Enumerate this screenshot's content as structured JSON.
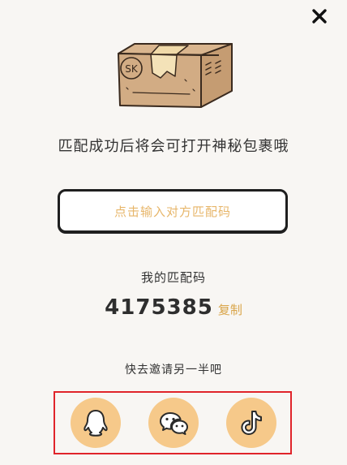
{
  "dialog": {
    "close_icon": "close-icon",
    "illustration": {
      "icon": "mystery-box",
      "label": "SK"
    },
    "headline": "匹配成功后将会可打开神秘包裹哦",
    "code_input": {
      "placeholder": "点击输入对方匹配码"
    },
    "my_code": {
      "label": "我的匹配码",
      "value": "4175385",
      "copy_label": "复制"
    },
    "invite": {
      "label": "快去邀请另一半吧"
    },
    "share": [
      {
        "icon": "qq-icon"
      },
      {
        "icon": "wechat-icon"
      },
      {
        "icon": "tiktok-icon"
      }
    ]
  },
  "colors": {
    "background": "#f8f6f3",
    "accent": "#f6c98a",
    "placeholder": "#e7b66a",
    "copy_link": "#d9a54a",
    "highlight_border": "#e0242a",
    "text": "#333333"
  }
}
